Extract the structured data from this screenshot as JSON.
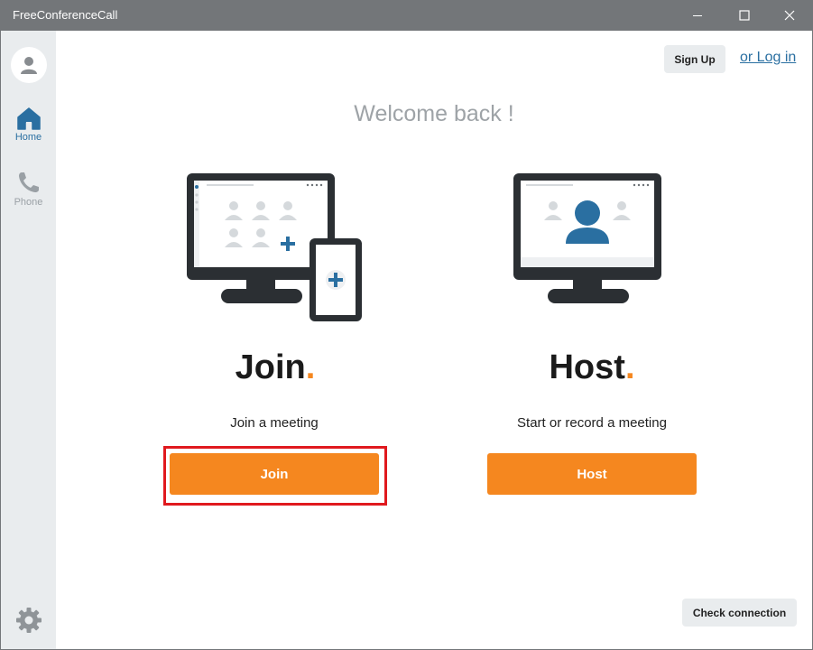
{
  "window": {
    "title": "FreeConferenceCall",
    "controls": {
      "minimize_icon": "minimize-icon",
      "maximize_icon": "maximize-icon",
      "close_icon": "close-icon"
    }
  },
  "sidebar": {
    "avatar_icon": "user-icon",
    "items": [
      {
        "label": "Home",
        "icon": "home-icon",
        "active": true
      },
      {
        "label": "Phone",
        "icon": "phone-icon",
        "active": false
      }
    ],
    "settings_icon": "gear-icon"
  },
  "header": {
    "signup_label": "Sign Up",
    "login_label": "or Log in"
  },
  "main": {
    "welcome": "Welcome back !",
    "join": {
      "heading": "Join",
      "heading_dot": ".",
      "subtitle": "Join a meeting",
      "button_label": "Join"
    },
    "host": {
      "heading": "Host",
      "heading_dot": ".",
      "subtitle": "Start or record a meeting",
      "button_label": "Host"
    },
    "check_connection_label": "Check connection"
  },
  "colors": {
    "titlebar": "#737679",
    "sidebar": "#e9ecee",
    "accent_orange": "#f5871f",
    "link_blue": "#2a6fa1",
    "highlight_red": "#e0191e",
    "welcome_gray": "#9ea3a7"
  }
}
